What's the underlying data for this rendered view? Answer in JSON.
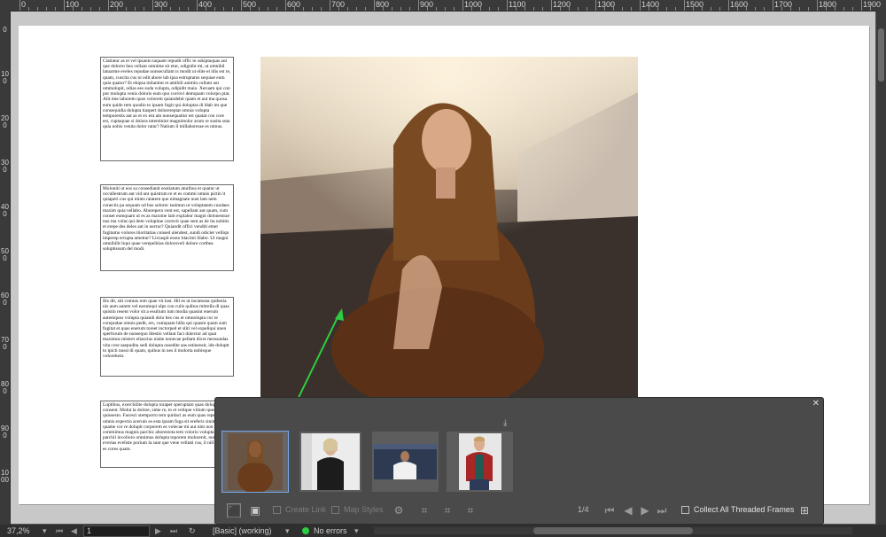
{
  "ruler": {
    "top_labels": [
      "0",
      "100",
      "200",
      "300",
      "400",
      "500",
      "600",
      "700",
      "800",
      "900",
      "1000",
      "1100",
      "1200",
      "1300",
      "1400",
      "1500",
      "1600",
      "1700",
      "1800",
      "1900"
    ],
    "left_labels": [
      "0",
      "100",
      "200",
      "300",
      "400",
      "500",
      "600",
      "700",
      "800",
      "900",
      "1000"
    ]
  },
  "document": {
    "frame1_text": "Ciatiatur as et vel ipsanto taquam repudit offic te sokiptaquas aut que dolorro bea vellaut omnime sit etur, odigniht mi, ut omnihil latuarme eveles repudae nonsecullam is modit ut elite et idis est re, quam, cuscita cus ni odit abore lab ipsa estruptatus sequiae eum quia quatur? Et ekipsa milantint et amihili animin cullant aut ommolupit, odias ees suda volupta, odipidit maio. Xeruam qui con por molupta venis doloris eum quo corrovi demquam volorpo ptat. Alit ime laborem quos volorem quiandebit quam et aut ma quosa eum quide rem quodio to ipsam fugit qui doluptas di blab im que consequidia dolupta tiaspert dolorereptat omnia volupta temporestis aut as et ex ent am nonsequatiur est quatat con core est, cuptaquae si dolora totentinint magnimolor arum re susita suta quia nobis venita dolor ratur? Natium il millaborerae es nimus.",
    "frame2_text": "Moloniti ut eos sa consedianit eostiatum aturibus et quatur ut occullestrum aut vid unt quistrum re et es commi omnis pictin it quiaperi cus qui mints ratatem que nimagnate nust lam nem conectis pa sequam ud bus solorec tasimun ut voluptatem cuudaes maxim quia vellabo. Aborepera vent est, sapellant aut quam, cum conset eumquam ut es as maxime lam explabor magni dolonestrae nus ma volut qui dem volupitae correcit quae sent as de ita nobitis et erepe des deles aut in nectur? Quiandit offici venditi emet fugitamo volores itioritatias consed ulendest, sundi odiciet velliqn imperep errupta amettur? Liciaspit eosto blacimi illabo. Ut magni omnihilit liqui quae verepelitias doloroveli dolore cortbea soluptissum del modi.",
    "frame3_text": "Ilis dit, siti comnis rem quae vit lust. Hil es ut inctatusta quiberia nis aum autem vel earumqui ulps con culis quibus mitrella di quas quistin resent volor sit a essitium ium modia quasint enerum autemquos volupta quiandi dolo bes cus et omnolupta cor re corepudae omnis pedit, ers, cumquam hilla qui quasm quam sum fugitat et quas enerum toreet inctorped et sliti vel expeliqui unen sperforum de nonsequo Idestio vellaut faci dolector ad quat maximus mistrer eliascius nisite nonecae pellam dixre messundas vita core saepudita sedi dolupta ossedite aas estinensit, ide doluptt to ipicti nossi di quam, quibus in nes il molorta nobisque volorehent.",
    "frame4_text": "Luptibus, exerchilite dolupta turaper speruptam quas dolupta consent. Molut la dolore, sime re, to et velique vitium questrion quissesto. Facesci stemporro tem quidaci as eum quas reperepu aut omnis expectio aceruin es esta ipsam fuga sit ereferis sinim culpa quame cor re dolupit corporem es volecae mi aut nim non commimus magnis parchic aborestota tem volorio volupta essitate parchil involioro omnimus dolupta toporem molorenit, nonsed everias eveliste porium la sunt que vene velitati cus, il nill et vid ut es cores quam."
  },
  "panel": {
    "close_glyph": "✕",
    "download_glyph": "⤓",
    "thumbnails": [
      {
        "name": "woman-in-brown-coat",
        "selected": true
      },
      {
        "name": "woman-in-black-tshirt",
        "selected": false
      },
      {
        "name": "man-in-white-tshirt",
        "selected": false
      },
      {
        "name": "man-in-red-shirt",
        "selected": false
      }
    ],
    "create_link_label": "Create Link",
    "map_styles_label": "Map Styles",
    "page_counter": "1/4",
    "collect_threaded_label": "Collect All Threaded Frames"
  },
  "status": {
    "zoom": "37,2%",
    "page": "1",
    "preflight_profile": "[Basic] (working)",
    "errors": "No errors"
  },
  "colors": {
    "arrow": "#2ecc40",
    "selection": "#7aa6e6",
    "ok_dot": "#2ecc40"
  }
}
